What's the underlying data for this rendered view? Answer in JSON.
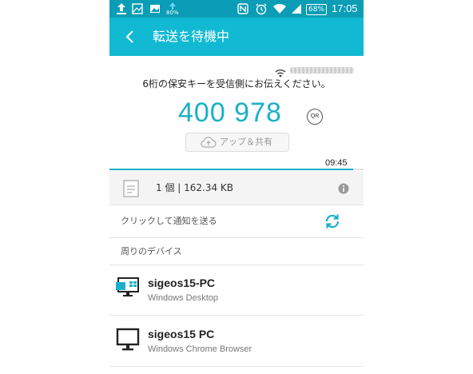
{
  "status_bar": {
    "battery_saver": "80%",
    "battery": "68%",
    "time": "17:05",
    "icons": [
      "upload-icon",
      "image-icon",
      "gallery-icon",
      "battery-saver-icon",
      "nfc-icon",
      "alarm-icon",
      "wifi-icon",
      "signal-icon",
      "battery-icon"
    ]
  },
  "app_bar": {
    "title": "転送を待機中",
    "back_icon": "back-arrow-icon"
  },
  "transfer": {
    "instruction": "6桁の保安キーを受信側にお伝えください。",
    "key": "400 978",
    "qr_label": "QR",
    "share_label": "アップ＆共有",
    "countdown": "09:45",
    "progress": 0.96
  },
  "file_info": {
    "text": "1 個 | 162.34 KB"
  },
  "notify": {
    "text": "クリックして通知を送る"
  },
  "devices_section": {
    "title": "周りのデバイス"
  },
  "devices": [
    {
      "name": "sigeos15-PC",
      "type": "Windows Desktop",
      "icon": "windows-pc-icon"
    },
    {
      "name": "sigeos15 PC",
      "type": "Windows Chrome Browser",
      "icon": "monitor-icon"
    }
  ],
  "colors": {
    "status_bar": "#0a9db5",
    "app_bar": "#12b9d2",
    "accent": "#1ab0c8"
  }
}
